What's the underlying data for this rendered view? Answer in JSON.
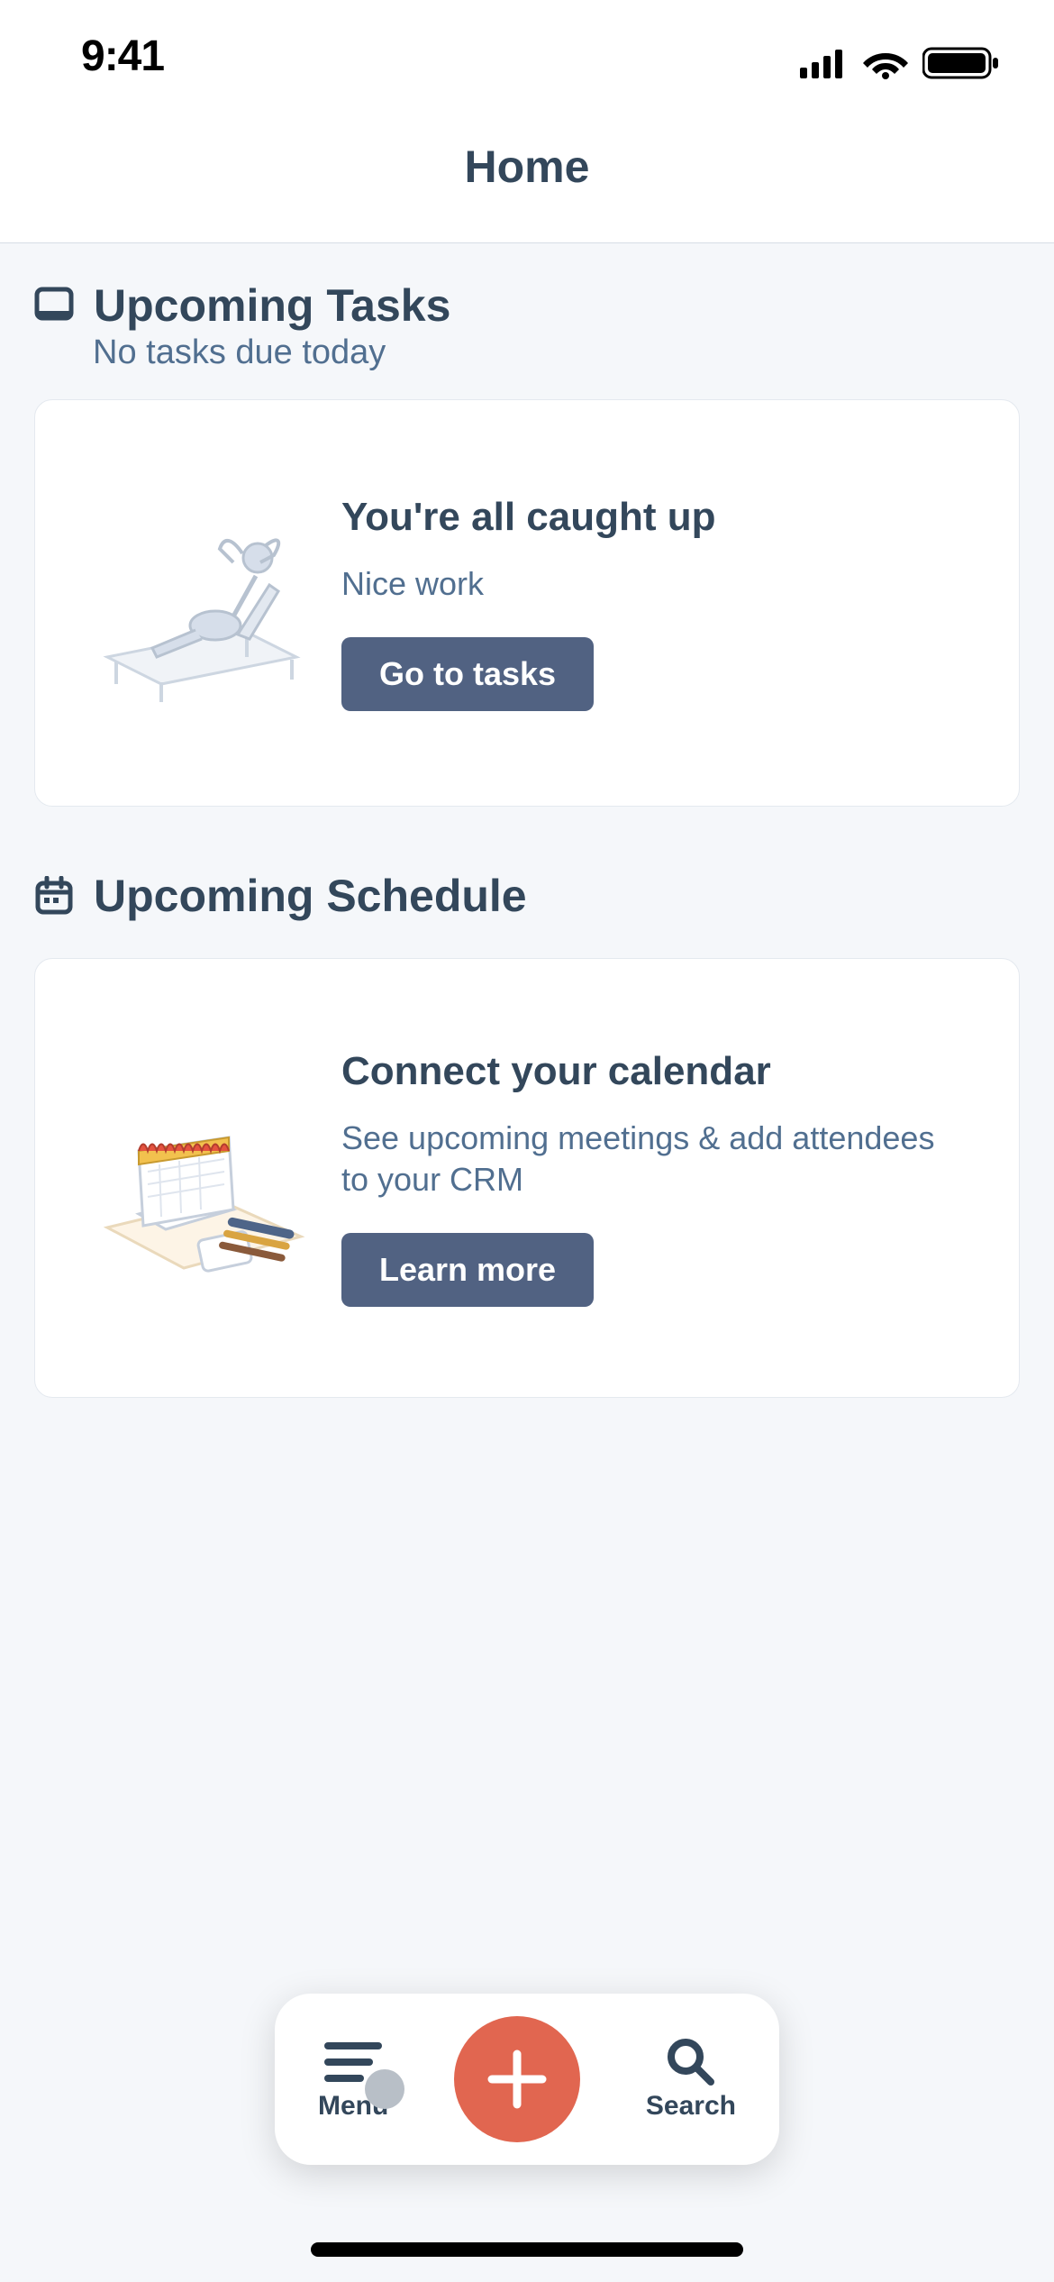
{
  "status": {
    "time": "9:41"
  },
  "header": {
    "title": "Home"
  },
  "tasks": {
    "section_title": "Upcoming Tasks",
    "subtitle": "No tasks due today",
    "card": {
      "title": "You're all caught up",
      "sub": "Nice work",
      "button": "Go to tasks"
    }
  },
  "schedule": {
    "section_title": "Upcoming Schedule",
    "card": {
      "title": "Connect your calendar",
      "sub": "See upcoming meetings & add attendees to your CRM",
      "button": "Learn more"
    }
  },
  "bottom": {
    "menu": "Menu",
    "search": "Search"
  }
}
